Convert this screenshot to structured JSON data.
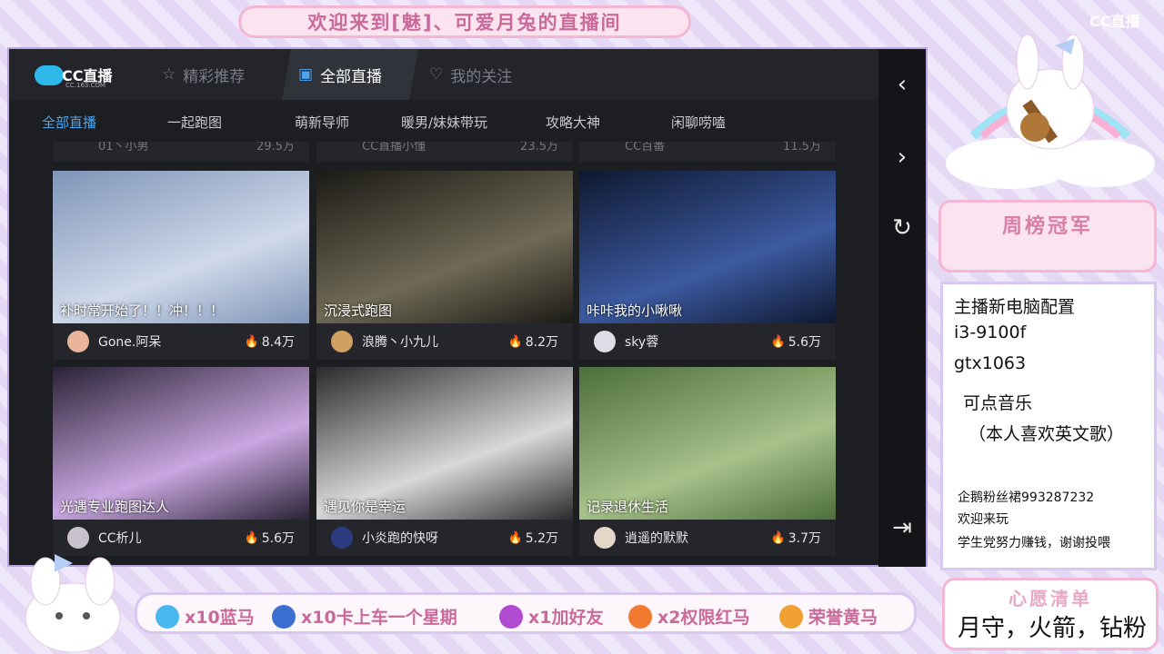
{
  "banner": {
    "title": "欢迎来到[魅]、可爱月兔的直播间"
  },
  "corner_logo": "CC直播",
  "app": {
    "logo": {
      "text": "CC直播",
      "url": "CC.163.COM"
    },
    "top_tabs": [
      {
        "label": "精彩推荐",
        "icon": "star-icon"
      },
      {
        "label": "全部直播",
        "icon": "tv-icon"
      },
      {
        "label": "我的关注",
        "icon": "heart-icon"
      }
    ],
    "categories": [
      "全部直播",
      "一起跑图",
      "萌新导师",
      "暖男/妹妹带玩",
      "攻略大神",
      "闲聊唠嗑"
    ],
    "partial_row": [
      {
        "name": "01丶小男",
        "views": "29.5万"
      },
      {
        "name": "CC直播小懂",
        "views": "23.5万"
      },
      {
        "name": "CC百番",
        "views": "11.5万"
      }
    ],
    "cards": [
      {
        "caption": "补时常开始了！！冲！！！",
        "streamer": "Gone.阿呆",
        "views": "8.4万",
        "colors": [
          "#7f95b8",
          "#cfd9ea"
        ],
        "avatar": "#e9b59a"
      },
      {
        "caption": "沉浸式跑图",
        "streamer": "浪腾丶小九儿",
        "views": "8.2万",
        "colors": [
          "#1b1a16",
          "#6f6a55"
        ],
        "avatar": "#d0a060"
      },
      {
        "caption": "咔咔我的小啾啾",
        "streamer": "sky蓉",
        "views": "5.6万",
        "colors": [
          "#0e1830",
          "#3c5aa0"
        ],
        "avatar": "#dddde6"
      },
      {
        "caption": "光遇专业跑图达人",
        "streamer": "CC析儿",
        "views": "5.6万",
        "colors": [
          "#2a2236",
          "#c9a7e0"
        ],
        "avatar": "#c7c2cc"
      },
      {
        "caption": "遇见你是幸运",
        "streamer": "小炎跑的快呀",
        "views": "5.2万",
        "colors": [
          "#2b2b2b",
          "#d8d8d8"
        ],
        "avatar": "#2a3b80"
      },
      {
        "caption": "记录退休生活",
        "streamer": "逍遥的默默",
        "views": "3.7万",
        "colors": [
          "#4d6e3a",
          "#a7c28b"
        ],
        "avatar": "#e4d7c8"
      }
    ]
  },
  "weekly_title": "周榜冠军",
  "info": {
    "line1": "主播新电脑配置",
    "line2": "i3-9100f",
    "line3": "gtx1063",
    "line4": "可点音乐",
    "line5": "（本人喜欢英文歌）",
    "line6": "企鹅粉丝裙993287232",
    "line7": "欢迎来玩",
    "line8": "学生党努力赚钱，谢谢投喂"
  },
  "wishlist": {
    "title": "心愿清单",
    "items": "月守，火箭，钻粉"
  },
  "gifts": [
    {
      "label": "x10蓝马",
      "color": "#4ab8f0"
    },
    {
      "label": "x10卡上车一个星期",
      "color": "#3a6fd0"
    },
    {
      "label": "x1加好友",
      "color": "#b04ad0"
    },
    {
      "label": "x2权限红马",
      "color": "#f07a30"
    },
    {
      "label": "荣誉黄马",
      "color": "#f0a030"
    }
  ]
}
